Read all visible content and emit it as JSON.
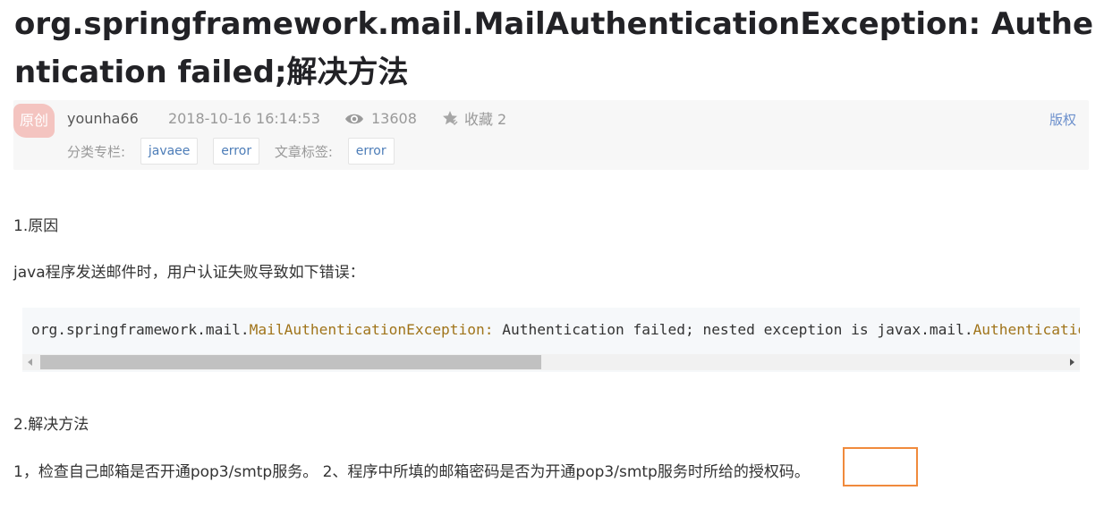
{
  "article": {
    "title": "org.springframework.mail.MailAuthenticationException: Authentication failed;解决方法",
    "badge": "原创",
    "author": "younha66",
    "date": "2018-10-16 16:14:53",
    "views": "13608",
    "favorite": "收藏 2",
    "copyright": "版权",
    "category_label": "分类专栏:",
    "categories": [
      "javaee",
      "error"
    ],
    "tags_label": "文章标签:",
    "tags": [
      "error"
    ],
    "section1_heading": "1.原因",
    "section1_text": "java程序发送邮件时，用户认证失败导致如下错误：",
    "code": {
      "part1": "org.springframework.mail.",
      "part2": "MailAuthenticationException:",
      "part3": " Authentication failed; nested exception is javax.mail.",
      "part4": "AuthenticationFailedException"
    },
    "section2_heading": "2.解决方法",
    "section2_text": "1，检查自己邮箱是否开通pop3/smtp服务。 2、程序中所填的邮箱密码是否为开通pop3/smtp服务时所给的授权码。"
  },
  "colors": {
    "highlight_border": "#f08a3c",
    "link": "#4d7db8",
    "code_highlight": "#a0741a"
  },
  "icons": {
    "views": "eye-icon",
    "favorite": "star-icon",
    "scroll_left": "chevron-left-icon",
    "scroll_right": "chevron-right-icon"
  }
}
